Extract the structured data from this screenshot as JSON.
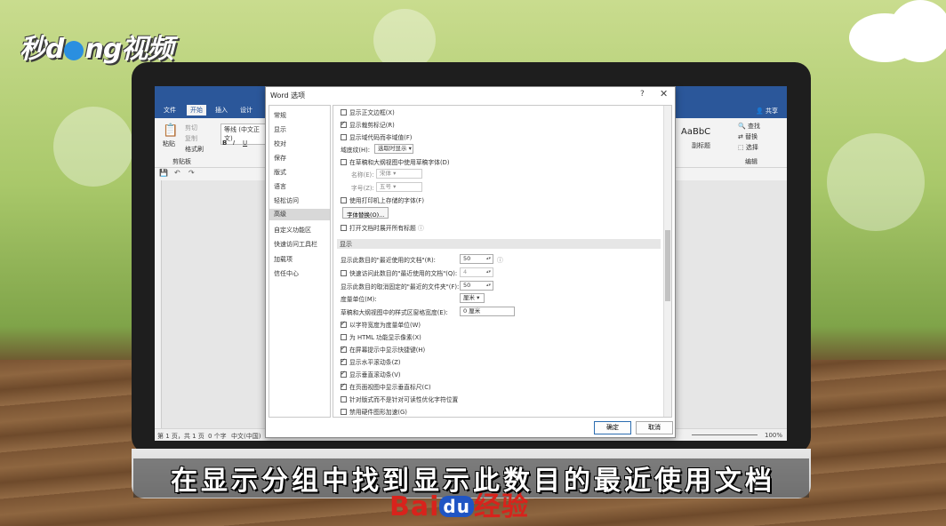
{
  "watermark_logo": {
    "prefix": "秒",
    "mid": "ng",
    "suffix": "视频",
    "o": "o"
  },
  "word": {
    "tabs": [
      "文件",
      "开始",
      "插入",
      "设计"
    ],
    "share": "共享",
    "ribbon": {
      "paste": "粘贴",
      "cut": "剪切",
      "copy": "复制",
      "format_painter": "格式刷",
      "clipboard_group": "剪贴板",
      "font": "等线 (中文正文)",
      "bold": "B",
      "italic": "I",
      "underline": "U",
      "style_sample": "AaBbC",
      "style_name": "副标题",
      "find": "查找",
      "replace": "替换",
      "select": "选择",
      "edit_group": "编辑"
    },
    "status": {
      "page": "第 1 页，共 1 页",
      "words": "0 个字",
      "lang": "中文(中国)",
      "zoom": "100%"
    }
  },
  "dialog": {
    "title": "Word 选项",
    "help": "?",
    "close": "✕",
    "nav": [
      "常规",
      "显示",
      "校对",
      "保存",
      "版式",
      "语言",
      "轻松访问",
      "高级",
      "自定义功能区",
      "快速访问工具栏",
      "加载项",
      "信任中心"
    ],
    "nav_active": "高级",
    "rows": {
      "show_text_boundaries": "显示正文边框(X)",
      "show_crop_marks": "显示裁剪标记(R)",
      "show_field_codes": "显示域代码而非域值(F)",
      "field_shading_label": "域底纹(H):",
      "field_shading_value": "选取时显示",
      "use_draft_font": "在草稿和大纲视图中使用草稿字体(D)",
      "name_label": "名称(E):",
      "name_value": "宋体",
      "size_label": "字号(Z):",
      "size_value": "五号",
      "use_printer_fonts": "使用打印机上存储的字体(F)",
      "font_sub_button": "字体替换(O)...",
      "expand_headings": "打开文档时展开所有标题",
      "section_display": "显示",
      "recent_docs_label": "显示此数目的\"最近使用的文档\"(R):",
      "recent_docs_value": "50",
      "quick_access_label": "快速访问此数目的\"最近使用的文档\"(Q):",
      "quick_access_value": "4",
      "recent_folders_label": "显示此数目的取消固定的\"最近的文件夹\"(F):",
      "recent_folders_value": "50",
      "unit_label": "度量单位(M):",
      "unit_value": "厘米",
      "style_width_label": "草稿和大纲视图中的样式区窗格宽度(E):",
      "style_width_value": "0 厘米",
      "char_width_units": "以字符宽度为度量单位(W)",
      "html_pixels": "为 HTML 功能显示像素(X)",
      "show_shortcut_keys": "在屏幕提示中显示快捷键(H)",
      "show_hscroll": "显示水平滚动条(Z)",
      "show_vscroll": "显示垂直滚动条(V)",
      "show_vruler": "在页面视图中显示垂直标尺(C)",
      "optimize_layout": "针对版式而不是针对可读性优化字符位置",
      "disable_hw_accel": "禁用硬件图形加速(G)"
    },
    "ok": "确定",
    "cancel": "取消"
  },
  "subtitle": "在显示分组中找到显示此数目的最近使用文档",
  "baidu_watermark": {
    "bai": "Bai",
    "du": "du",
    "jingyan": "经验"
  }
}
